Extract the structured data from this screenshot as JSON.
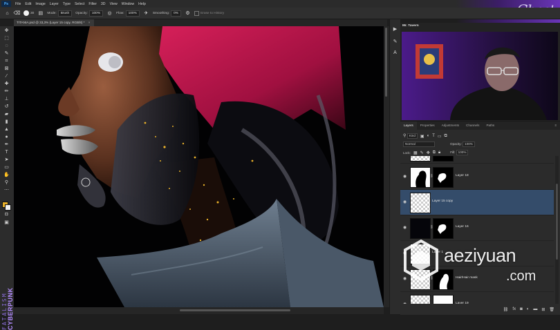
{
  "menubar": {
    "app_icon": "Ps",
    "items": [
      "File",
      "Edit",
      "Image",
      "Layer",
      "Type",
      "Select",
      "Filter",
      "3D",
      "View",
      "Window",
      "Help"
    ],
    "brand_text": "Ghost"
  },
  "options": {
    "mode_label": "Mode:",
    "mode_value": "Brush",
    "opacity_label": "Opacity:",
    "opacity_value": "100%",
    "flow_label": "Flow:",
    "flow_value": "100%",
    "smoothing_label": "Smoothing:",
    "smoothing_value": "0%",
    "erase_label": "Erase to History",
    "brush_size": "30"
  },
  "document": {
    "tab_title": "TITANIA.psd @ 33,3% (Layer 15 copy, RGB/8) *",
    "tab_close": "×"
  },
  "side_brand": {
    "line1": "FATALISM",
    "line2": "CYBERPUNK"
  },
  "webcam": {
    "title": "Mr. Tavern"
  },
  "layers_panel": {
    "tabs": [
      "Layers",
      "Properties",
      "Adjustments",
      "Channels",
      "Paths"
    ],
    "kind_label": "Kind",
    "blend_mode": "Normal",
    "opacity_label": "Opacity:",
    "opacity_value": "100%",
    "lock_label": "Lock:",
    "fill_label": "Fill:",
    "fill_value": "100%",
    "layers": [
      {
        "name": "Layer 18"
      },
      {
        "name": "Layer 15 copy"
      },
      {
        "name": "Layer 16"
      },
      {
        "name": "Layer 1"
      },
      {
        "name": "Hair/Hair mask"
      },
      {
        "name": "Layer 19"
      }
    ]
  },
  "watermark": {
    "line1": "aeziyuan",
    "line2": ".com"
  },
  "colors": {
    "foreground": "#e8b02a",
    "background": "#f0f0f0",
    "accent": "#344c6a",
    "hair": "#c01747"
  },
  "icons": {
    "toolbar": [
      "move-icon",
      "marquee-icon",
      "lasso-icon",
      "quick-select-icon",
      "crop-icon",
      "frame-icon",
      "eyedropper-icon",
      "healing-icon",
      "brush-icon",
      "stamp-icon",
      "history-brush-icon",
      "eraser-icon",
      "gradient-icon",
      "blur-icon",
      "dodge-icon",
      "pen-icon",
      "type-icon",
      "path-select-icon",
      "rectangle-icon",
      "hand-icon",
      "zoom-icon",
      "more-icon"
    ]
  }
}
